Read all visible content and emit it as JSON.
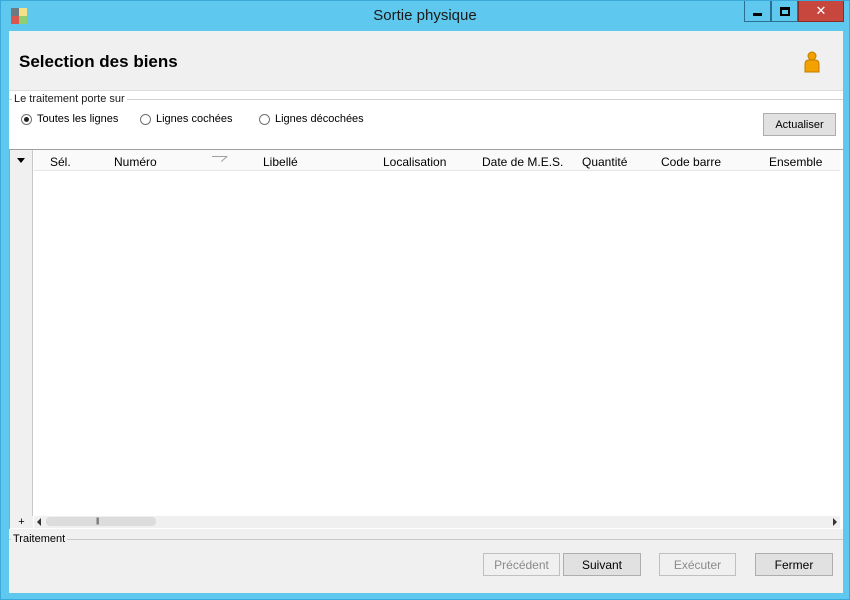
{
  "window": {
    "title": "Sortie physique",
    "controls": [
      "minimize",
      "maximize",
      "close"
    ],
    "close_glyph": "✕"
  },
  "header": {
    "title": "Selection des biens",
    "user_icon": "user-icon"
  },
  "selection_group": {
    "legend": "Le traitement porte sur",
    "options": [
      {
        "label": "Toutes les lignes",
        "checked": true
      },
      {
        "label": "Lignes cochées",
        "checked": false
      },
      {
        "label": "Lignes décochées",
        "checked": false
      }
    ],
    "refresh_label": "Actualiser"
  },
  "grid": {
    "columns": [
      "Sél.",
      "Numéro",
      "Libellé",
      "Localisation",
      "Date de M.E.S.",
      "Quantité",
      "Code barre",
      "Ensemble"
    ],
    "rows": [],
    "add_label": "+",
    "scroll_grip": "|||"
  },
  "footer": {
    "legend": "Traitement",
    "buttons": {
      "previous": "Précédent",
      "next": "Suivant",
      "execute": "Exécuter",
      "close": "Fermer"
    }
  },
  "colors": {
    "titlebar": "#5ec8ee",
    "close_button": "#c7463d",
    "client_bg": "#f0f0f0"
  }
}
